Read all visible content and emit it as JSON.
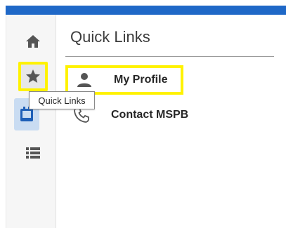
{
  "rail": {
    "items": [
      {
        "icon": "home-icon"
      },
      {
        "icon": "star-icon"
      },
      {
        "icon": "contact-card-icon"
      },
      {
        "icon": "list-icon"
      }
    ]
  },
  "tooltip": {
    "text": "Quick Links"
  },
  "panel": {
    "title": "Quick Links",
    "links": [
      {
        "label": "My Profile",
        "icon": "person-icon"
      },
      {
        "label": "Contact MSPB",
        "icon": "phone-icon"
      }
    ]
  },
  "colors": {
    "accent": "#1f68c7",
    "highlight": "#fff200",
    "rail_bg": "#f6f6f6",
    "active_item_bg": "#c9dcf2",
    "icon_gray": "#555555",
    "icon_blue": "#1d5fb8"
  }
}
